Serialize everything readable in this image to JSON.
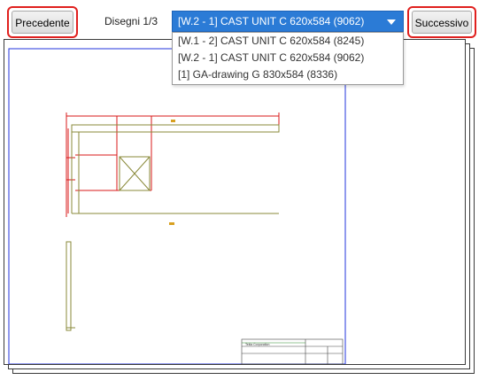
{
  "toolbar": {
    "prev_label": "Precedente",
    "next_label": "Successivo",
    "counter": "Disegni 1/3"
  },
  "select": {
    "selected": "[W.2 - 1] CAST UNIT C 620x584 (9062)",
    "options": [
      "[W.1 - 2] CAST UNIT C 620x584 (8245)",
      "[W.2 - 1] CAST UNIT C 620x584 (9062)",
      "[1] GA-drawing G 830x584 (8336)"
    ]
  },
  "drawing": {
    "company": "Tekla Corporation"
  },
  "colors": {
    "accent": "#2b7bd6",
    "highlight": "#e0201e"
  }
}
